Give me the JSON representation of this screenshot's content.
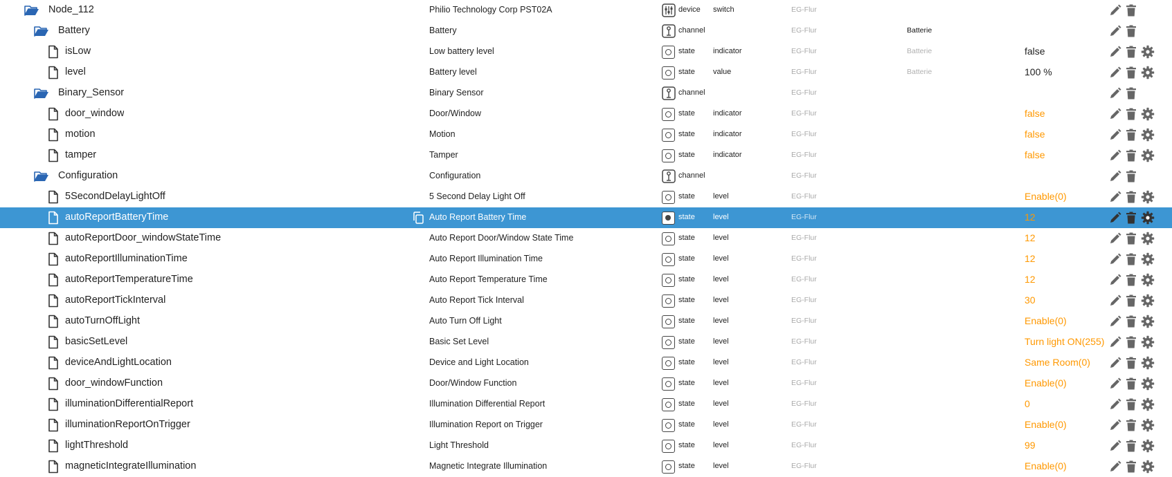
{
  "colors": {
    "selected_row": "#3d96d3",
    "folder": "#2a66b3",
    "value_acked": "#222222",
    "value_not_acked": "#ff9800",
    "action_icon": "#666666"
  },
  "rows": [
    {
      "depth": 0,
      "kind": "folder",
      "name": "Node_112",
      "desc": "Philio Technology Corp PST02A",
      "type_icon": "device-icon",
      "type": "device",
      "role": "switch",
      "room": "EG-Flur",
      "func": "",
      "value": "",
      "value_color": "",
      "actions": [
        "edit",
        "delete"
      ],
      "selected": false
    },
    {
      "depth": 1,
      "kind": "folder",
      "name": "Battery",
      "desc": "Battery",
      "type_icon": "channel-icon",
      "type": "channel",
      "role": "",
      "room": "EG-Flur",
      "func": "Batterie",
      "func_dim": false,
      "value": "",
      "value_color": "",
      "actions": [
        "edit",
        "delete"
      ],
      "selected": false
    },
    {
      "depth": 2,
      "kind": "file",
      "name": "isLow",
      "desc": "Low battery level",
      "type_icon": "state-icon",
      "type": "state",
      "role": "indicator",
      "room": "EG-Flur",
      "func": "Batterie",
      "func_dim": true,
      "value": "false",
      "value_color": "black",
      "actions": [
        "edit",
        "delete",
        "settings"
      ],
      "selected": false
    },
    {
      "depth": 2,
      "kind": "file",
      "name": "level",
      "desc": "Battery level",
      "type_icon": "state-icon",
      "type": "state",
      "role": "value",
      "room": "EG-Flur",
      "func": "Batterie",
      "func_dim": true,
      "value": "100 %",
      "value_color": "black",
      "actions": [
        "edit",
        "delete",
        "settings"
      ],
      "selected": false
    },
    {
      "depth": 1,
      "kind": "folder",
      "name": "Binary_Sensor",
      "desc": "Binary Sensor",
      "type_icon": "channel-icon",
      "type": "channel",
      "role": "",
      "room": "EG-Flur",
      "func": "",
      "value": "",
      "value_color": "",
      "actions": [
        "edit",
        "delete"
      ],
      "selected": false
    },
    {
      "depth": 2,
      "kind": "file",
      "name": "door_window",
      "desc": "Door/Window",
      "type_icon": "state-icon",
      "type": "state",
      "role": "indicator",
      "room": "EG-Flur",
      "func": "",
      "value": "false",
      "value_color": "orange",
      "actions": [
        "edit",
        "delete",
        "settings"
      ],
      "selected": false
    },
    {
      "depth": 2,
      "kind": "file",
      "name": "motion",
      "desc": "Motion",
      "type_icon": "state-icon",
      "type": "state",
      "role": "indicator",
      "room": "EG-Flur",
      "func": "",
      "value": "false",
      "value_color": "orange",
      "actions": [
        "edit",
        "delete",
        "settings"
      ],
      "selected": false
    },
    {
      "depth": 2,
      "kind": "file",
      "name": "tamper",
      "desc": "Tamper",
      "type_icon": "state-icon",
      "type": "state",
      "role": "indicator",
      "room": "EG-Flur",
      "func": "",
      "value": "false",
      "value_color": "orange",
      "actions": [
        "edit",
        "delete",
        "settings"
      ],
      "selected": false
    },
    {
      "depth": 1,
      "kind": "folder",
      "name": "Configuration",
      "desc": "Configuration",
      "type_icon": "channel-icon",
      "type": "channel",
      "role": "",
      "room": "EG-Flur",
      "func": "",
      "value": "",
      "value_color": "",
      "actions": [
        "edit",
        "delete"
      ],
      "selected": false
    },
    {
      "depth": 2,
      "kind": "file",
      "name": "5SecondDelayLightOff",
      "desc": "5 Second Delay Light Off",
      "type_icon": "state-icon",
      "type": "state",
      "role": "level",
      "room": "EG-Flur",
      "func": "",
      "value": "Enable(0)",
      "value_color": "orange",
      "actions": [
        "edit",
        "delete",
        "settings"
      ],
      "selected": false
    },
    {
      "depth": 2,
      "kind": "file",
      "name": "autoReportBatteryTime",
      "desc": "Auto Report Battery Time",
      "type_icon": "state-icon",
      "type": "state",
      "role": "level",
      "room": "EG-Flur",
      "func": "",
      "value": "12",
      "value_color": "orange",
      "actions": [
        "edit",
        "delete",
        "settings"
      ],
      "selected": true
    },
    {
      "depth": 2,
      "kind": "file",
      "name": "autoReportDoor_windowStateTime",
      "desc": "Auto Report Door/Window State Time",
      "type_icon": "state-icon",
      "type": "state",
      "role": "level",
      "room": "EG-Flur",
      "func": "",
      "value": "12",
      "value_color": "orange",
      "actions": [
        "edit",
        "delete",
        "settings"
      ],
      "selected": false
    },
    {
      "depth": 2,
      "kind": "file",
      "name": "autoReportIlluminationTime",
      "desc": "Auto Report Illumination Time",
      "type_icon": "state-icon",
      "type": "state",
      "role": "level",
      "room": "EG-Flur",
      "func": "",
      "value": "12",
      "value_color": "orange",
      "actions": [
        "edit",
        "delete",
        "settings"
      ],
      "selected": false
    },
    {
      "depth": 2,
      "kind": "file",
      "name": "autoReportTemperatureTime",
      "desc": "Auto Report Temperature Time",
      "type_icon": "state-icon",
      "type": "state",
      "role": "level",
      "room": "EG-Flur",
      "func": "",
      "value": "12",
      "value_color": "orange",
      "actions": [
        "edit",
        "delete",
        "settings"
      ],
      "selected": false
    },
    {
      "depth": 2,
      "kind": "file",
      "name": "autoReportTickInterval",
      "desc": "Auto Report Tick Interval",
      "type_icon": "state-icon",
      "type": "state",
      "role": "level",
      "room": "EG-Flur",
      "func": "",
      "value": "30",
      "value_color": "orange",
      "actions": [
        "edit",
        "delete",
        "settings"
      ],
      "selected": false
    },
    {
      "depth": 2,
      "kind": "file",
      "name": "autoTurnOffLight",
      "desc": "Auto Turn Off Light",
      "type_icon": "state-icon",
      "type": "state",
      "role": "level",
      "room": "EG-Flur",
      "func": "",
      "value": "Enable(0)",
      "value_color": "orange",
      "actions": [
        "edit",
        "delete",
        "settings"
      ],
      "selected": false
    },
    {
      "depth": 2,
      "kind": "file",
      "name": "basicSetLevel",
      "desc": "Basic Set Level",
      "type_icon": "state-icon",
      "type": "state",
      "role": "level",
      "room": "EG-Flur",
      "func": "",
      "value": "Turn light ON(255)",
      "value_color": "orange",
      "actions": [
        "edit",
        "delete",
        "settings"
      ],
      "selected": false
    },
    {
      "depth": 2,
      "kind": "file",
      "name": "deviceAndLightLocation",
      "desc": "Device and Light Location",
      "type_icon": "state-icon",
      "type": "state",
      "role": "level",
      "room": "EG-Flur",
      "func": "",
      "value": "Same Room(0)",
      "value_color": "orange",
      "actions": [
        "edit",
        "delete",
        "settings"
      ],
      "selected": false
    },
    {
      "depth": 2,
      "kind": "file",
      "name": "door_windowFunction",
      "desc": "Door/Window Function",
      "type_icon": "state-icon",
      "type": "state",
      "role": "level",
      "room": "EG-Flur",
      "func": "",
      "value": "Enable(0)",
      "value_color": "orange",
      "actions": [
        "edit",
        "delete",
        "settings"
      ],
      "selected": false
    },
    {
      "depth": 2,
      "kind": "file",
      "name": "illuminationDifferentialReport",
      "desc": "Illumination Differential Report",
      "type_icon": "state-icon",
      "type": "state",
      "role": "level",
      "room": "EG-Flur",
      "func": "",
      "value": "0",
      "value_color": "orange",
      "actions": [
        "edit",
        "delete",
        "settings"
      ],
      "selected": false
    },
    {
      "depth": 2,
      "kind": "file",
      "name": "illuminationReportOnTrigger",
      "desc": "Illumination Report on Trigger",
      "type_icon": "state-icon",
      "type": "state",
      "role": "level",
      "room": "EG-Flur",
      "func": "",
      "value": "Enable(0)",
      "value_color": "orange",
      "actions": [
        "edit",
        "delete",
        "settings"
      ],
      "selected": false
    },
    {
      "depth": 2,
      "kind": "file",
      "name": "lightThreshold",
      "desc": "Light Threshold",
      "type_icon": "state-icon",
      "type": "state",
      "role": "level",
      "room": "EG-Flur",
      "func": "",
      "value": "99",
      "value_color": "orange",
      "actions": [
        "edit",
        "delete",
        "settings"
      ],
      "selected": false
    },
    {
      "depth": 2,
      "kind": "file",
      "name": "magneticIntegrateIllumination",
      "desc": "Magnetic Integrate Illumination",
      "type_icon": "state-icon",
      "type": "state",
      "role": "level",
      "room": "EG-Flur",
      "func": "",
      "value": "Enable(0)",
      "value_color": "orange",
      "actions": [
        "edit",
        "delete",
        "settings"
      ],
      "selected": false
    }
  ]
}
